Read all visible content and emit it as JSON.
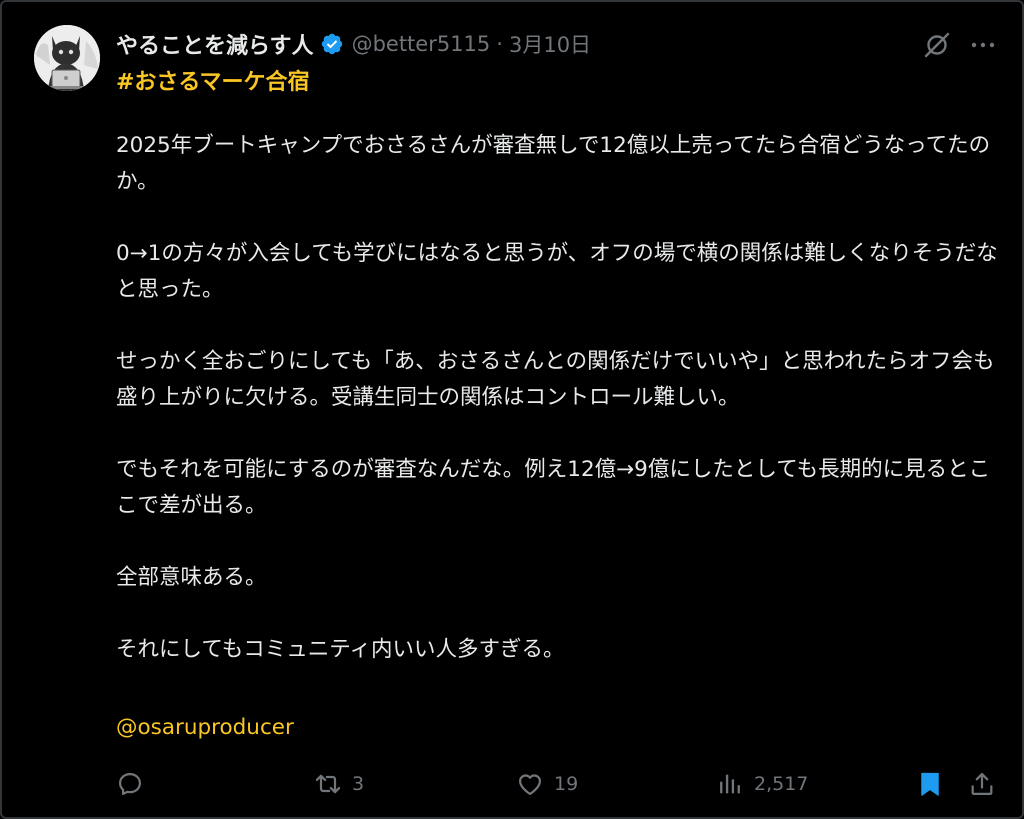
{
  "post": {
    "author": {
      "display_name": "やることを減らす人",
      "handle": "@better5115",
      "separator": "·",
      "date": "3月10日",
      "avatar": "cat-with-laptop-avatar",
      "verified_icon": "verified-badge-icon"
    },
    "hashtag": "#おさるマーケ合宿",
    "paragraphs": [
      "2025年ブートキャンプでおさるさんが審査無しで12億以上売ってたら合宿どうなってたのか。",
      "0→1の方々が入会しても学びにはなると思うが、オフの場で横の関係は難しくなりそうだなと思った。",
      "せっかく全おごりにしても「あ、おさるさんとの関係だけでいいや」と思われたらオフ会も盛り上がりに欠ける。受講生同士の関係はコントロール難しい。",
      "でもそれを可能にするのが審査なんだな。例え12億→9億にしたとしても長期的に見るとここで差が出る。",
      "全部意味ある。",
      "それにしてもコミュニティ内いい人多すぎる。"
    ],
    "mention": "@osaruproducer",
    "actions": {
      "reply": {
        "icon": "reply-icon",
        "count": ""
      },
      "retweet": {
        "icon": "retweet-icon",
        "count": "3"
      },
      "like": {
        "icon": "heart-icon",
        "count": "19"
      },
      "views": {
        "icon": "views-chart-icon",
        "count": "2,517"
      },
      "bookmark": {
        "icon": "bookmark-icon",
        "state": "bookmarked"
      },
      "share": {
        "icon": "share-icon"
      }
    },
    "header_icons": [
      "grok-icon",
      "more-icon"
    ]
  },
  "colors": {
    "background": "#000000",
    "text": "#e7e9ea",
    "muted": "#71767b",
    "accent_yellow": "#f9c623",
    "verified_blue": "#1d9bf0",
    "bookmark_blue": "#1d9bf0"
  }
}
